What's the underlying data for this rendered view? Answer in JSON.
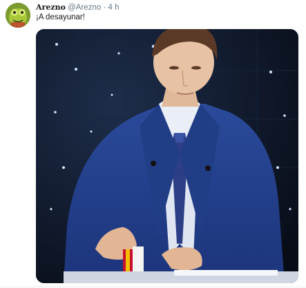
{
  "tweet": {
    "display_name": "Arezno",
    "handle": "@Arezno",
    "separator": "·",
    "time": "4 h",
    "text": "¡A desayunar!"
  },
  "media": {
    "icon": "photo",
    "alt": ""
  },
  "colors": {
    "name": "#14171a",
    "meta": "#657786",
    "suit": "#24408a",
    "tie": "#2c3f86"
  }
}
